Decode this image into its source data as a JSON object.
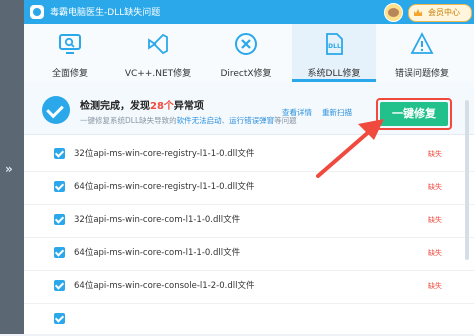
{
  "app": {
    "title": "毒霸电脑医生-DLL缺失问题",
    "member_label": "会员中心"
  },
  "toolbar": [
    {
      "label": "全面修复",
      "icon": "monitor-scan-icon",
      "active": false
    },
    {
      "label": "VC++.NET修复",
      "icon": "visual-studio-icon",
      "active": false
    },
    {
      "label": "DirectX修复",
      "icon": "directx-icon",
      "active": false
    },
    {
      "label": "系统DLL修复",
      "icon": "dll-file-icon",
      "active": true
    },
    {
      "label": "错误问题修复",
      "icon": "warning-icon",
      "active": false
    }
  ],
  "scan": {
    "prefix": "检测完成，发现",
    "count": "28个",
    "suffix": "异常项",
    "sub_prefix": "一键修复系统DLL缺失导致的",
    "sub_link1": "软件无法启动",
    "sub_sep": "、",
    "sub_link2": "运行错误弹窗",
    "sub_suffix": "等问题",
    "view_details": "查看详情",
    "rescan": "重新扫描",
    "repair_label": "一键修复"
  },
  "files": [
    {
      "name": "32位api-ms-win-core-registry-l1-1-0.dll文件",
      "status": "缺失"
    },
    {
      "name": "64位api-ms-win-core-registry-l1-1-0.dll文件",
      "status": "缺失"
    },
    {
      "name": "32位api-ms-win-core-com-l1-1-0.dll文件",
      "status": "缺失"
    },
    {
      "name": "64位api-ms-win-core-com-l1-1-0.dll文件",
      "status": "缺失"
    },
    {
      "name": "64位api-ms-win-core-console-l1-2-0.dll文件",
      "status": "缺失"
    }
  ],
  "colors": {
    "accent": "#2aa8ea",
    "repair_green": "#22c08a",
    "alert_red": "#f04a3e"
  }
}
